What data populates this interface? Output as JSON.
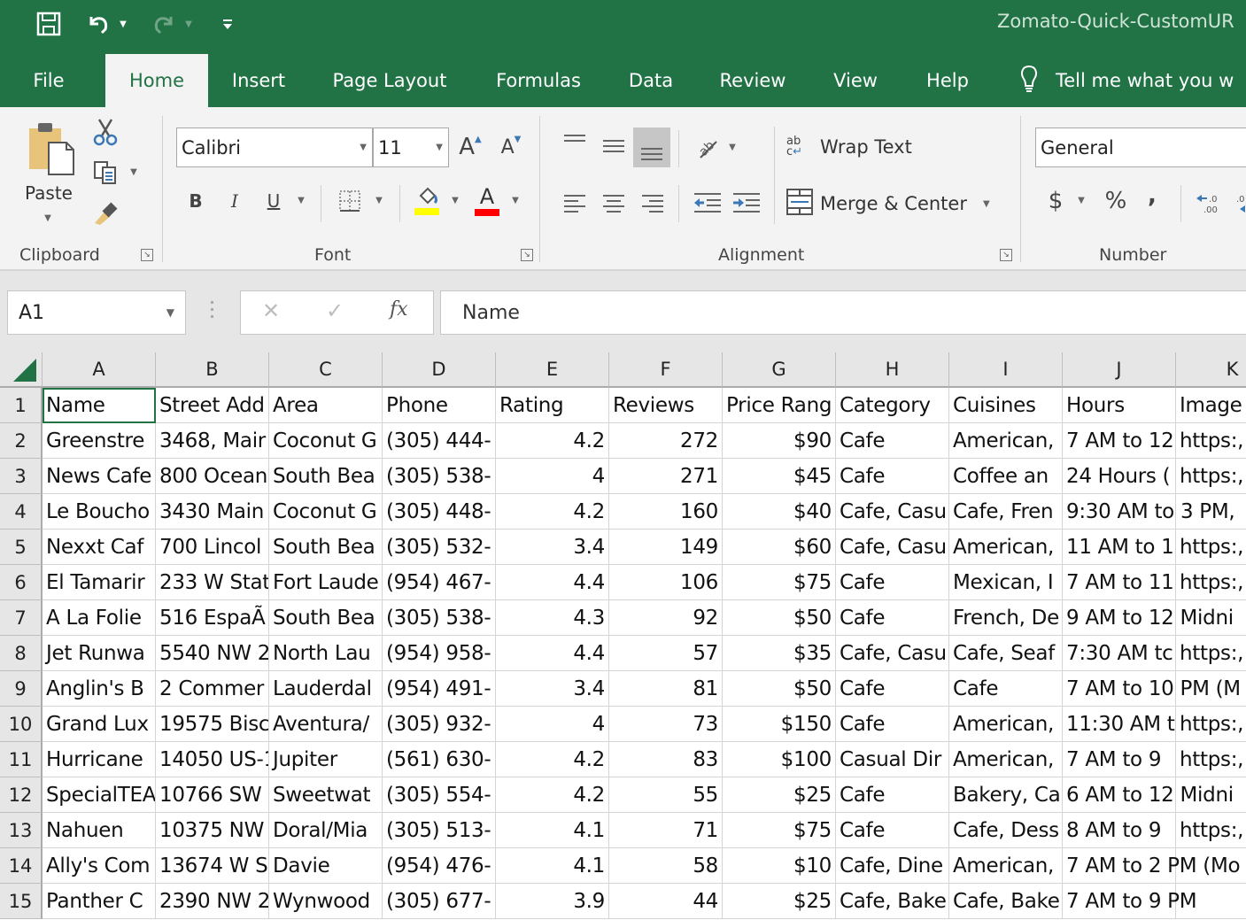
{
  "app": {
    "document_title": "Zomato-Quick-CustomUR",
    "accent_color": "#217346"
  },
  "quick_access": {
    "save_icon": "save-icon",
    "undo_icon": "undo-icon",
    "redo_icon": "redo-icon",
    "customize_icon": "customize-qat-icon"
  },
  "tabs": [
    {
      "label": "File",
      "active": false
    },
    {
      "label": "Home",
      "active": true
    },
    {
      "label": "Insert",
      "active": false
    },
    {
      "label": "Page Layout",
      "active": false
    },
    {
      "label": "Formulas",
      "active": false
    },
    {
      "label": "Data",
      "active": false
    },
    {
      "label": "Review",
      "active": false
    },
    {
      "label": "View",
      "active": false
    },
    {
      "label": "Help",
      "active": false
    }
  ],
  "tell_me": "Tell me what you w",
  "ribbon": {
    "clipboard": {
      "label": "Clipboard",
      "paste_label": "Paste"
    },
    "font": {
      "label": "Font",
      "font_name": "Calibri",
      "font_size": "11",
      "bold": "B",
      "italic": "I",
      "underline": "U",
      "fill_color": "#ffff00",
      "font_color": "#ff0000"
    },
    "alignment": {
      "label": "Alignment",
      "wrap_text": "Wrap Text",
      "merge_center": "Merge & Center"
    },
    "number": {
      "label": "Number",
      "format": "General",
      "currency": "$",
      "percent": "%",
      "comma": ","
    }
  },
  "formula_bar": {
    "name_box": "A1",
    "cancel": "✕",
    "enter": "✓",
    "fx": "fx",
    "content": "Name"
  },
  "sheet": {
    "columns": [
      "A",
      "B",
      "C",
      "D",
      "E",
      "F",
      "G",
      "H",
      "I",
      "J",
      "K"
    ],
    "row_numbers": [
      "1",
      "2",
      "3",
      "4",
      "5",
      "6",
      "7",
      "8",
      "9",
      "10",
      "11",
      "12",
      "13",
      "14",
      "15"
    ],
    "rows": [
      [
        "Name",
        "Street Add",
        "Area",
        "Phone",
        "Rating",
        "Reviews",
        "Price Rang",
        "Category",
        "Cuisines",
        "Hours",
        "Image"
      ],
      [
        "Greenstre",
        "3468, Mair",
        "Coconut G",
        "(305) 444-",
        "4.2",
        "272",
        "$90",
        "Cafe",
        "American,",
        "7 AM to 12",
        "https:,"
      ],
      [
        "News Cafe",
        "800 Ocean",
        "South Bea",
        "(305) 538-",
        "4",
        "271",
        "$45",
        "Cafe",
        "Coffee an",
        "24 Hours (",
        "https:,"
      ],
      [
        "Le Boucho",
        "3430 Main",
        "Coconut G",
        "(305) 448-",
        "4.2",
        "160",
        "$40",
        "Cafe, Casu",
        "Cafe, Fren",
        "9:30 AM to 3 PM,",
        ""
      ],
      [
        "Nexxt Caf",
        "700 Lincol",
        "South Bea",
        "(305) 532-",
        "3.4",
        "149",
        "$60",
        "Cafe, Casu",
        "American,",
        "11 AM to 1",
        "https:,"
      ],
      [
        "El Tamarir",
        "233 W Stat",
        "Fort Laude",
        "(954) 467-",
        "4.4",
        "106",
        "$75",
        "Cafe",
        "Mexican, I",
        "7 AM to 11",
        "https:,"
      ],
      [
        "A La Folie",
        "516 EspaÃ",
        "South Bea",
        "(305) 538-",
        "4.3",
        "92",
        "$50",
        "Cafe",
        "French, De",
        "9 AM to 12 Midni",
        ""
      ],
      [
        "Jet Runwa",
        "5540 NW 2",
        "North Lau",
        "(954) 958-",
        "4.4",
        "57",
        "$35",
        "Cafe, Casu",
        "Cafe, Seaf",
        "7:30 AM tc",
        "https:,"
      ],
      [
        "Anglin's B",
        "2 Commer",
        "Lauderdal",
        "(954) 491-",
        "3.4",
        "81",
        "$50",
        "Cafe",
        "Cafe",
        "7 AM to 10 PM (M",
        ""
      ],
      [
        "Grand Lux",
        "19575 Bisc",
        "Aventura/",
        "(305) 932-",
        "4",
        "73",
        "$150",
        "Cafe",
        "American,",
        "11:30 AM t",
        "https:,"
      ],
      [
        "Hurricane",
        "14050 US-1",
        "Jupiter",
        "(561) 630-",
        "4.2",
        "83",
        "$100",
        "Casual Dir",
        "American,",
        "7 AM to 9",
        "https:,"
      ],
      [
        "SpecialTEA",
        "10766 SW",
        "Sweetwat",
        "(305) 554-",
        "4.2",
        "55",
        "$25",
        "Cafe",
        "Bakery, Ca",
        "6 AM to 12 Midni",
        ""
      ],
      [
        "Nahuen",
        "10375 NW",
        "Doral/Mia",
        "(305) 513-",
        "4.1",
        "71",
        "$75",
        "Cafe",
        "Cafe, Dess",
        "8 AM to 9",
        "https:,"
      ],
      [
        "Ally's Com",
        "13674 W S",
        "Davie",
        "(954) 476-",
        "4.1",
        "58",
        "$10",
        "Cafe, Dine",
        "American,",
        "7 AM to 2 PM (Mo",
        ""
      ],
      [
        "Panther C",
        "2390 NW 2",
        "Wynwood",
        "(305) 677-",
        "3.9",
        "44",
        "$25",
        "Cafe, Bake",
        "Cafe, Bake",
        "7 AM to 9 PM",
        ""
      ]
    ],
    "numeric_columns": [
      4,
      5,
      6
    ],
    "selected_cell": "A1"
  }
}
